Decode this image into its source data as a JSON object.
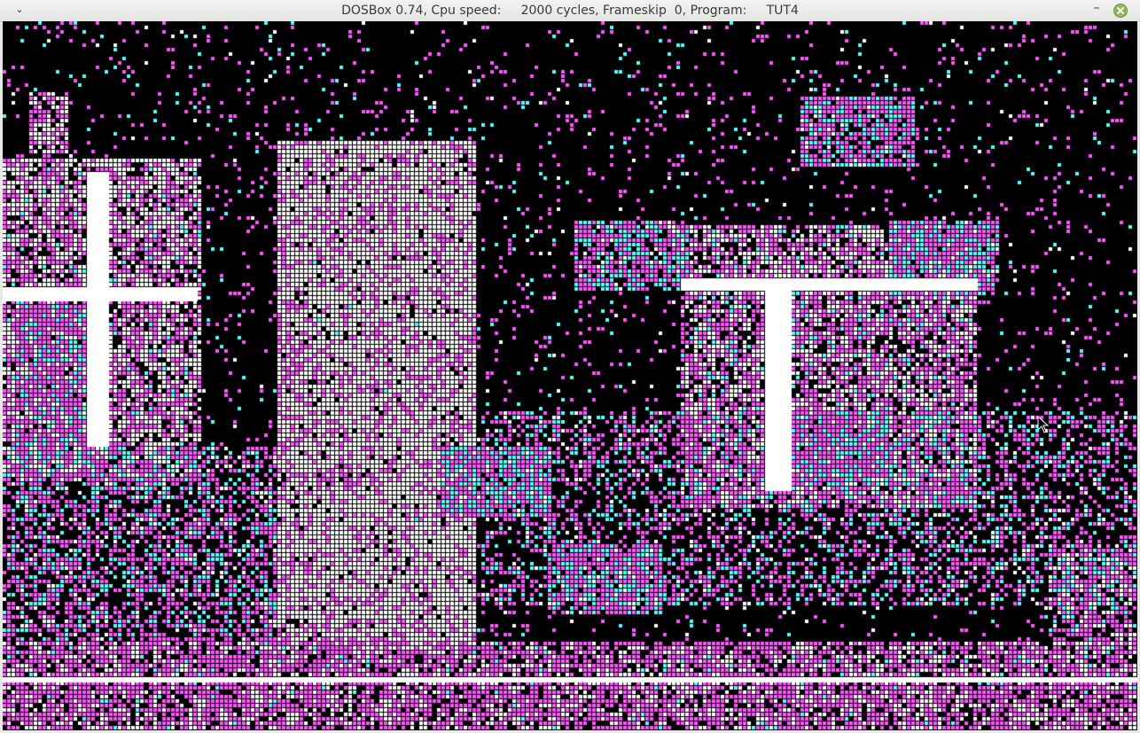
{
  "window": {
    "title": "DOSBox 0.74, Cpu speed:     2000 cycles, Frameskip  0, Program:     TUT4",
    "menu_icon": "chevron-down-icon",
    "minimize_icon": "minimize-icon",
    "close_icon": "close-icon"
  },
  "screen": {
    "palette": {
      "background": "#000000",
      "magenta": "#ff55ff",
      "cyan": "#55ffff",
      "white": "#ffffff"
    },
    "content": "CGA 4-color dithered photograph of a street scene with buildings, a doorway and trees",
    "cursor_icon": "mouse-pointer-icon"
  }
}
